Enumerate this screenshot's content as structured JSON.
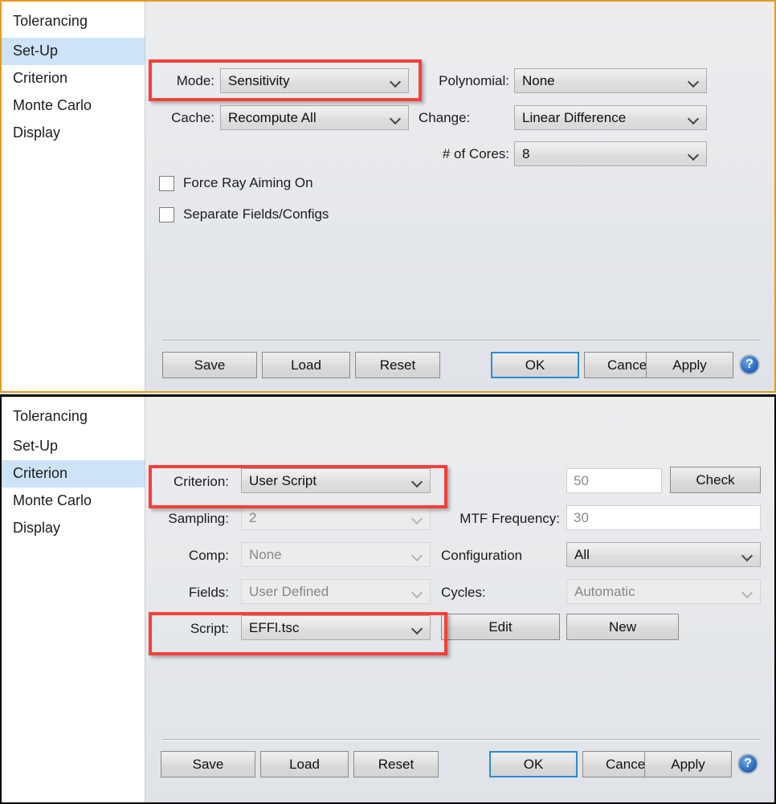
{
  "colors": {
    "accent_highlight": "#f6403a",
    "selected_item": "#cde3f7",
    "top_window_border": "#e59a21",
    "bottom_window_border": "#000000",
    "primary_button_border": "#2a8bd8"
  },
  "top_dialog": {
    "sidebar": {
      "title": "Tolerancing",
      "items": [
        {
          "label": "Set-Up",
          "selected": true
        },
        {
          "label": "Criterion",
          "selected": false
        },
        {
          "label": "Monte Carlo",
          "selected": false
        },
        {
          "label": "Display",
          "selected": false
        }
      ]
    },
    "fields": {
      "mode_label": "Mode:",
      "mode_value": "Sensitivity",
      "polynomial_label": "Polynomial:",
      "polynomial_value": "None",
      "cache_label": "Cache:",
      "cache_value": "Recompute All",
      "change_label": "Change:",
      "change_value": "Linear Difference",
      "cores_label": "# of Cores:",
      "cores_value": "8"
    },
    "checkboxes": [
      {
        "label": "Force Ray Aiming On",
        "checked": false
      },
      {
        "label": "Separate Fields/Configs",
        "checked": false
      }
    ],
    "buttons": {
      "save": "Save",
      "load": "Load",
      "reset": "Reset",
      "ok": "OK",
      "cancel": "Cancel",
      "apply": "Apply",
      "help": "?"
    }
  },
  "bottom_dialog": {
    "sidebar": {
      "title": "Tolerancing",
      "items": [
        {
          "label": "Set-Up",
          "selected": false
        },
        {
          "label": "Criterion",
          "selected": true
        },
        {
          "label": "Monte Carlo",
          "selected": false
        },
        {
          "label": "Display",
          "selected": false
        }
      ]
    },
    "fields": {
      "criterion_label": "Criterion:",
      "criterion_value": "User Script",
      "percent_value": "50",
      "check_button": "Check",
      "sampling_label": "Sampling:",
      "sampling_value": "2",
      "mtf_frequency_label": "MTF Frequency:",
      "mtf_frequency_value": "30",
      "comp_label": "Comp:",
      "comp_value": "None",
      "configuration_label": "Configuration",
      "configuration_value": "All",
      "fields_label": "Fields:",
      "fields_value": "User Defined",
      "cycles_label": "Cycles:",
      "cycles_value": "Automatic",
      "script_label": "Script:",
      "script_value": "EFFl.tsc",
      "edit_button": "Edit",
      "new_button": "New"
    },
    "buttons": {
      "save": "Save",
      "load": "Load",
      "reset": "Reset",
      "ok": "OK",
      "cancel": "Cancel",
      "apply": "Apply",
      "help": "?"
    }
  }
}
